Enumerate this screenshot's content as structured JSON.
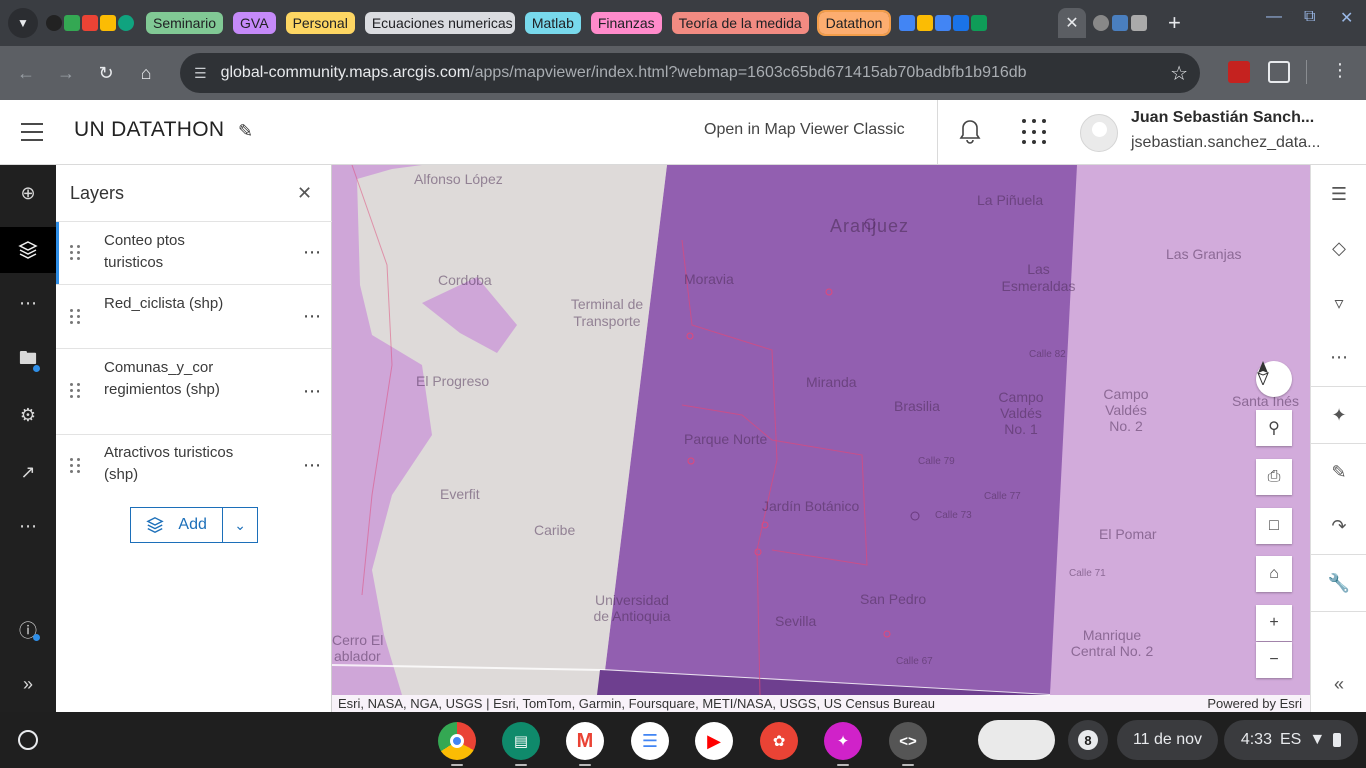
{
  "browser": {
    "tab_groups": [
      {
        "label": "Seminario",
        "color": "#81c995"
      },
      {
        "label": "GVA",
        "color": "#c58af9"
      },
      {
        "label": "Personal",
        "color": "#fdd663"
      },
      {
        "label": "Ecuaciones numericas",
        "color": "#dadce0"
      },
      {
        "label": "Matlab",
        "color": "#78d9ec"
      },
      {
        "label": "Finanzas",
        "color": "#ff8bcb"
      },
      {
        "label": "Teoría de la medida",
        "color": "#f28b82"
      },
      {
        "label": "Datathon",
        "color": "#fcad70"
      }
    ],
    "url_host": "global-community.maps.arcgis.com",
    "url_path": "/apps/mapviewer/index.html?webmap=1603c65bd671415ab70badbfb1b916db"
  },
  "header": {
    "title": "UN DATATHON",
    "open_classic": "Open in Map Viewer Classic",
    "user_name": "Juan Sebastián Sanch...",
    "user_email": "jsebastian.sanchez_data..."
  },
  "layers_panel": {
    "title": "Layers",
    "layers": [
      {
        "name": "Conteo ptos turisticos"
      },
      {
        "name": "Red_ciclista (shp)"
      },
      {
        "name": "Comunas_y_cor regimientos (shp)"
      },
      {
        "name": "Atractivos turisticos (shp)"
      }
    ],
    "add_label": "Add"
  },
  "map": {
    "labels": [
      "Alfonso López",
      "Cordoba",
      "El Progreso",
      "Everfit",
      "Caribe",
      "Terminal de Transporte",
      "Moravia",
      "Aranjuez",
      "La Piñuela",
      "Las Esmeraldas",
      "Las Granjas",
      "Miranda",
      "Brasilia",
      "Campo Valdés No. 1",
      "Campo Valdés No. 2",
      "Parque Norte",
      "Jardín Botánico",
      "El Pomar",
      "Universidad de Antioquia",
      "San Pedro",
      "Sevilla",
      "Manrique Central No. 2",
      "Cerro El",
      "ablador",
      "Santa Inés",
      "Calle 79",
      "Calle 77",
      "Calle 73",
      "Calle 71",
      "Calle 67",
      "Calle 82"
    ],
    "attribution": "Esri, NASA, NGA, USGS | Esri, TomTom, Garmin, Foursquare, METI/NASA, USGS, US Census Bureau",
    "powered_by": "Powered by Esri",
    "colors": {
      "light": "#cfa6d8",
      "dark": "#925fb0",
      "gray": "#dedad9",
      "road": "#e0487a"
    }
  },
  "shelf": {
    "notification_count": "8",
    "date": "11 de nov",
    "time": "4:33",
    "locale": "ES"
  }
}
